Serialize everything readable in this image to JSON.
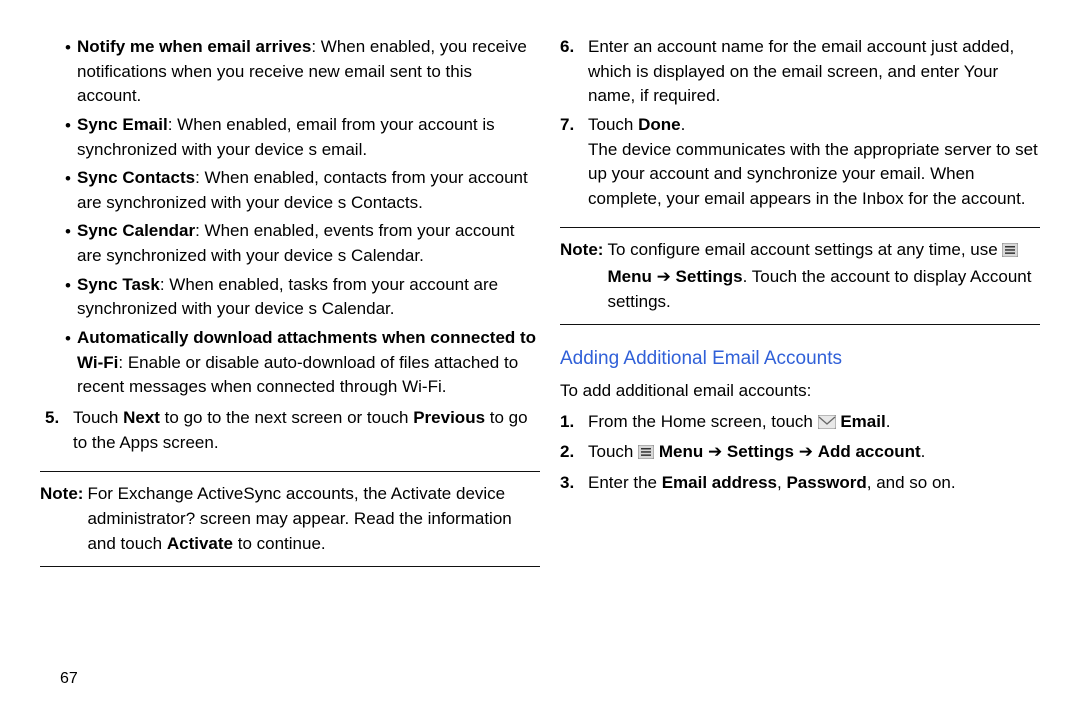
{
  "left": {
    "bullets": [
      {
        "bold": "Notify me when email arrives",
        "rest": ": When enabled, you receive notifications when you receive new email sent to this account."
      },
      {
        "bold": "Sync Email",
        "rest": ": When enabled, email from your account is synchronized with your device s email."
      },
      {
        "bold": "Sync Contacts",
        "rest": ": When enabled, contacts from your account are synchronized with your device s Contacts."
      },
      {
        "bold": "Sync Calendar",
        "rest": ": When enabled, events from your account are synchronized with your device s Calendar."
      },
      {
        "bold": "Sync Task",
        "rest": ": When enabled, tasks from your account are synchronized with your device s Calendar."
      },
      {
        "bold": "Automatically download attachments when connected to Wi-Fi",
        "rest": ": Enable or disable auto-download of files attached to recent messages when connected through Wi-Fi."
      }
    ],
    "step5": {
      "num": "5.",
      "pre": "Touch ",
      "b1": "Next",
      "mid": " to go to the next screen or touch ",
      "b2": "Previous",
      "post": " to go to the Apps screen."
    },
    "note": {
      "label": "Note:",
      "body_pre": " For Exchange ActiveSync accounts, the Activate device administrator? screen may appear. Read the information and touch ",
      "b1": "Activate",
      "body_post": " to continue."
    }
  },
  "right": {
    "step6": {
      "num": "6.",
      "text": "Enter an account name for the email account just added, which is displayed on the email screen, and enter Your name, if required."
    },
    "step7": {
      "num": "7.",
      "pre": "Touch ",
      "b1": "Done",
      "post": ".",
      "cont": "The device communicates with the appropriate server to set up your account and synchronize your email. When complete, your email appears in the Inbox for the account."
    },
    "note": {
      "label": "Note:",
      "pre": " To configure email account settings at any time, use ",
      "menu_word": "Menu",
      "arrow": " ➔ ",
      "settings_word": "Settings",
      "post": ". Touch the account to display Account settings."
    },
    "heading": "Adding Additional Email Accounts",
    "intro": "To add additional email accounts:",
    "add1": {
      "num": "1.",
      "pre": "From the Home screen, touch ",
      "email_word": "Email",
      "post": "."
    },
    "add2": {
      "num": "2.",
      "pre": "Touch ",
      "menu_word": "Menu",
      "arrow1": " ➔ ",
      "settings_word": "Settings",
      "arrow2": " ➔ ",
      "add_word": "Add account",
      "post": "."
    },
    "add3": {
      "num": "3.",
      "pre": "Enter the ",
      "b1": "Email address",
      "mid": ", ",
      "b2": "Password",
      "post": ", and so on."
    }
  },
  "pageNumber": "67"
}
